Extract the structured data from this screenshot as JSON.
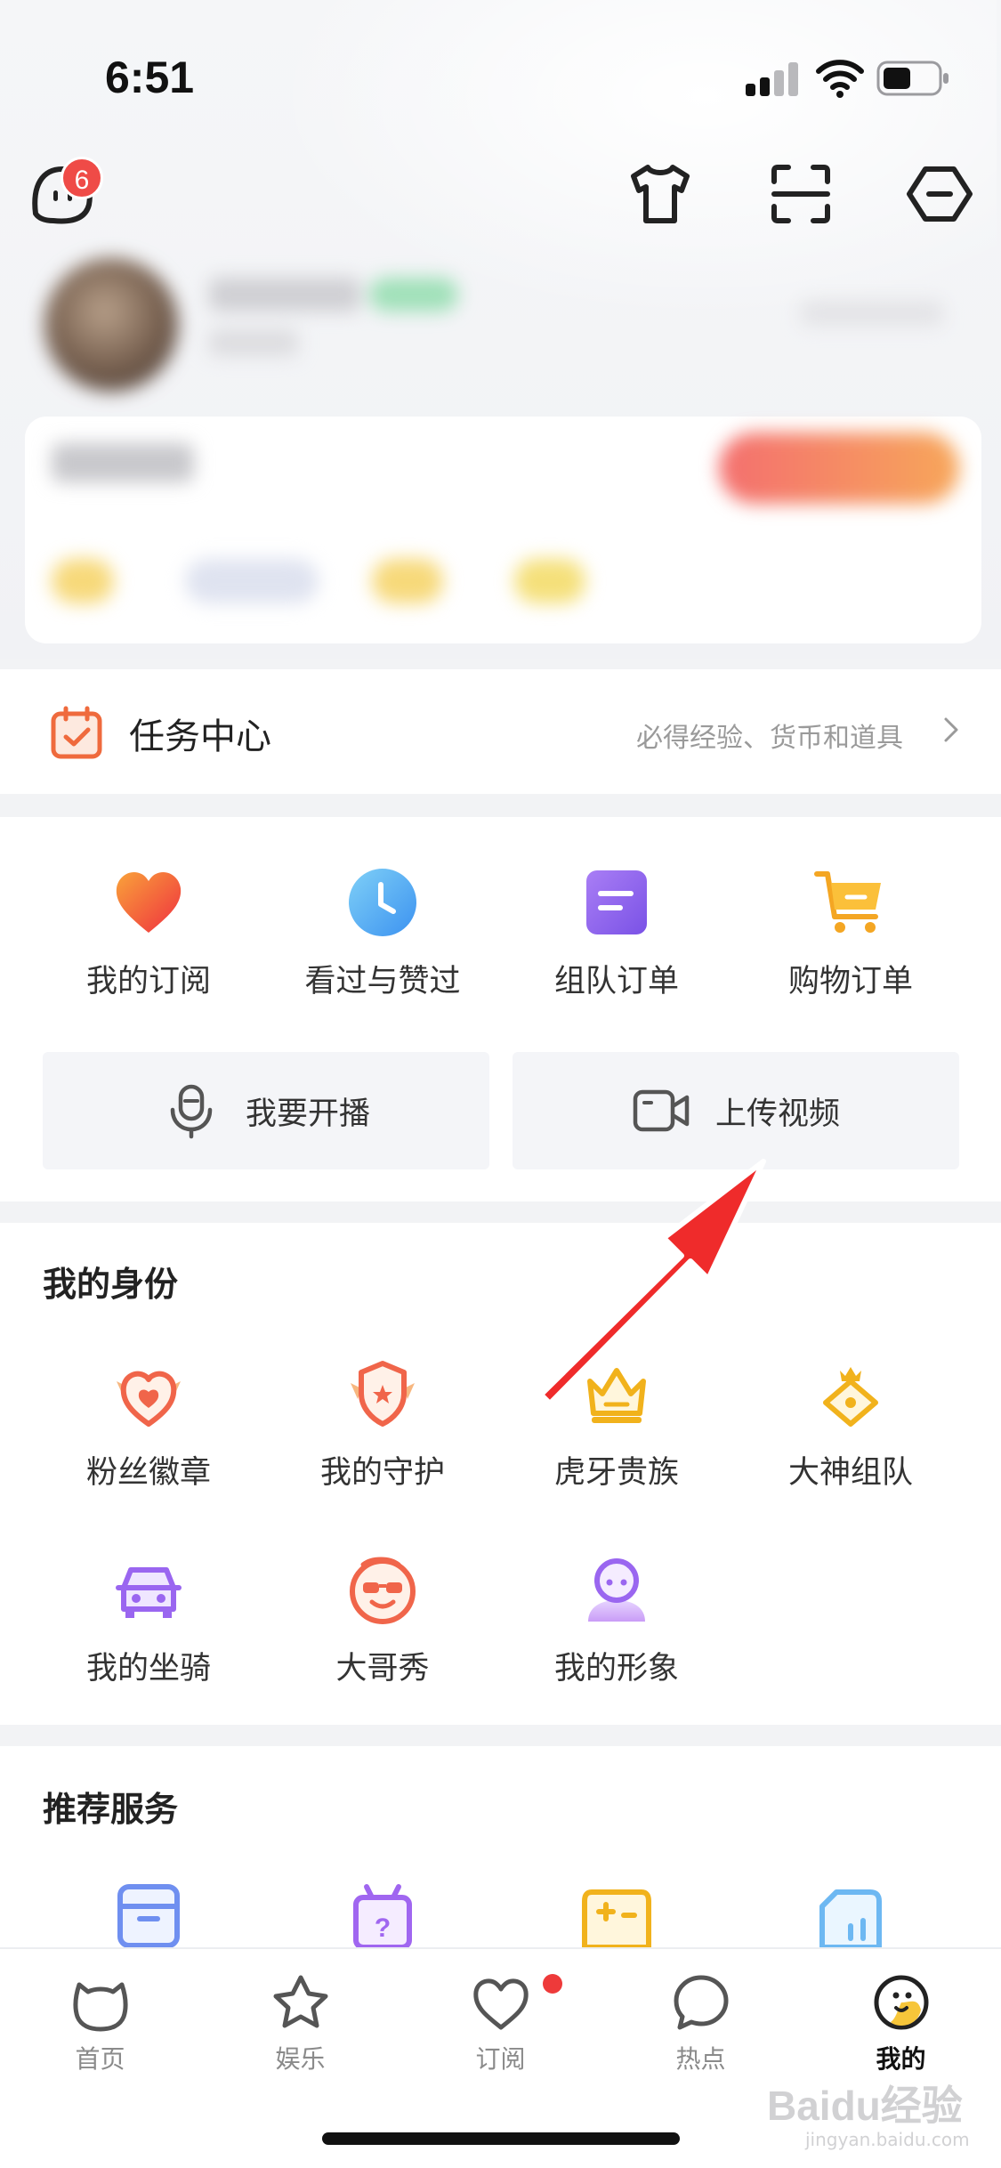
{
  "status_bar": {
    "time": "6:51"
  },
  "header": {
    "message_badge": "6"
  },
  "task_center": {
    "title": "任务中心",
    "subtitle": "必得经验、货币和道具"
  },
  "quick_grid": [
    {
      "label": "我的订阅",
      "icon": "heart-icon"
    },
    {
      "label": "看过与赞过",
      "icon": "clock-icon"
    },
    {
      "label": "组队订单",
      "icon": "document-icon"
    },
    {
      "label": "购物订单",
      "icon": "cart-icon"
    }
  ],
  "actions": {
    "live": {
      "label": "我要开播",
      "icon": "microphone-icon"
    },
    "upload": {
      "label": "上传视频",
      "icon": "video-camera-icon"
    }
  },
  "identity": {
    "title": "我的身份",
    "items": [
      {
        "label": "粉丝徽章",
        "icon": "fan-badge-icon"
      },
      {
        "label": "我的守护",
        "icon": "guard-shield-icon"
      },
      {
        "label": "虎牙贵族",
        "icon": "crown-icon"
      },
      {
        "label": "大神组队",
        "icon": "team-crown-icon"
      },
      {
        "label": "我的坐骑",
        "icon": "car-icon"
      },
      {
        "label": "大哥秀",
        "icon": "sunglasses-face-icon"
      },
      {
        "label": "我的形象",
        "icon": "avatar-person-icon"
      }
    ]
  },
  "recommend": {
    "title": "推荐服务",
    "icons": [
      "storage-box-icon",
      "gift-box-icon",
      "gamepad-icon",
      "chart-card-icon"
    ]
  },
  "tabbar": {
    "tabs": [
      {
        "label": "首页",
        "icon": "home-mascot-icon"
      },
      {
        "label": "娱乐",
        "icon": "star-icon"
      },
      {
        "label": "订阅",
        "icon": "heart-outline-icon"
      },
      {
        "label": "热点",
        "icon": "chat-bubble-icon"
      },
      {
        "label": "我的",
        "icon": "me-mascot-icon"
      }
    ],
    "active_index": 4
  },
  "watermark": {
    "main": "Baidu经验",
    "sub": "jingyan.baidu.com"
  },
  "colors": {
    "accent_red": "#ef2b2b",
    "badge_red": "#ef4b47",
    "task_orange": "#ef6a3d"
  }
}
